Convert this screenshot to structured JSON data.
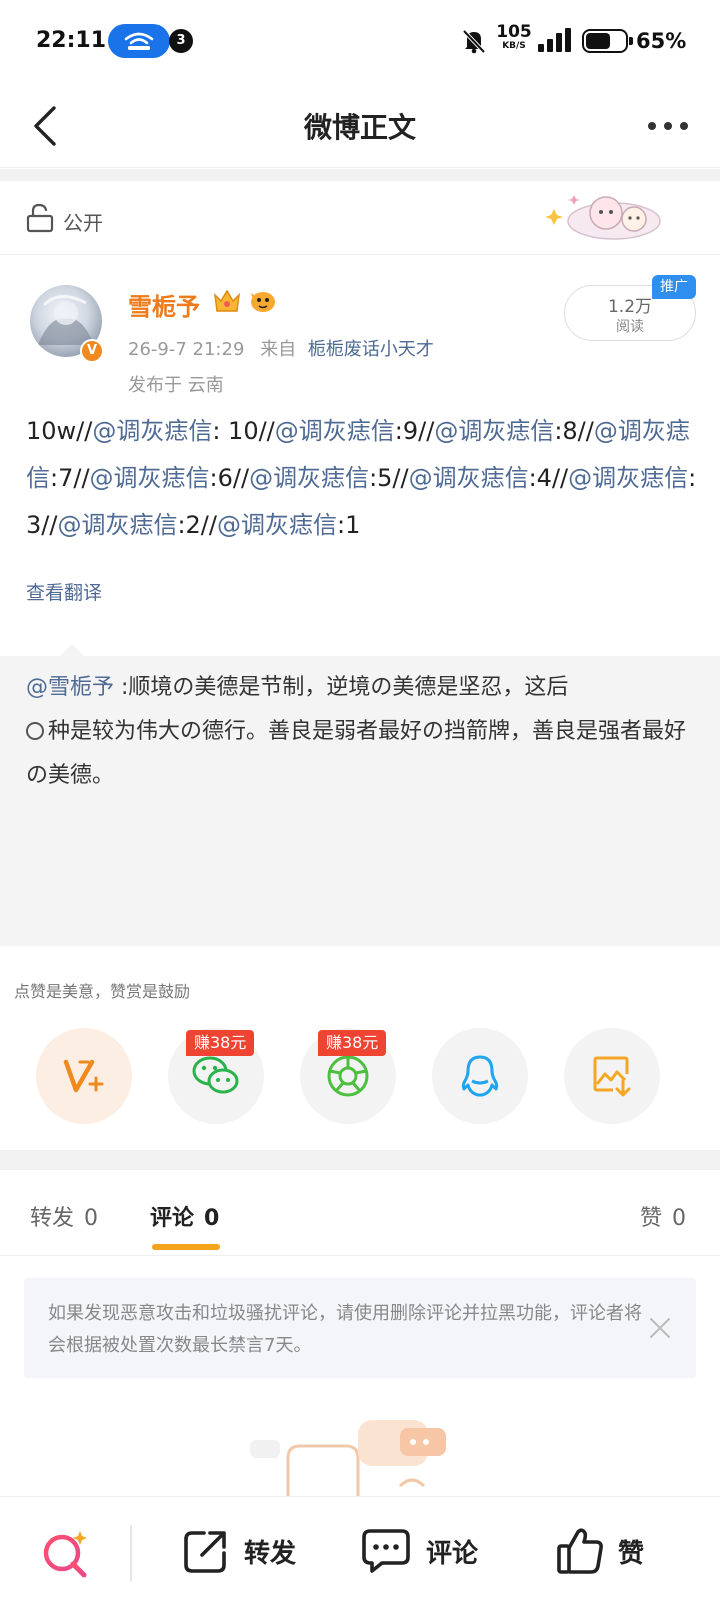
{
  "status_bar": {
    "time": "22:11",
    "notif_count": "3",
    "net_speed_value": "105",
    "net_speed_unit": "KB/S",
    "battery_pct": "65%",
    "battery_level": 0.65
  },
  "nav": {
    "title": "微博正文"
  },
  "visibility": {
    "label": "公开"
  },
  "author": {
    "name": "雪栀予",
    "verified_badge": "V",
    "date": "26-9-7 21:29",
    "from_prefix": "来自",
    "source": "栀栀废话小天才",
    "location": "发布于 云南",
    "reads_count": "1.2万",
    "reads_label": "阅读",
    "promo_label": "推广"
  },
  "post": {
    "segments": [
      {
        "t": "10w//",
        "m": false
      },
      {
        "t": "@调灰痣信",
        "m": true
      },
      {
        "t": ": 10//",
        "m": false
      },
      {
        "t": "@调灰痣信",
        "m": true
      },
      {
        "t": ":9//",
        "m": false
      },
      {
        "t": "@调灰痣信",
        "m": true
      },
      {
        "t": ":8//",
        "m": false
      },
      {
        "t": "@调灰痣信",
        "m": true
      },
      {
        "t": ":7//",
        "m": false
      },
      {
        "t": "@调灰痣信",
        "m": true
      },
      {
        "t": ":6//",
        "m": false
      },
      {
        "t": "@调灰痣信",
        "m": true
      },
      {
        "t": ":5//",
        "m": false
      },
      {
        "t": "@调灰痣信",
        "m": true
      },
      {
        "t": ":4//",
        "m": false
      },
      {
        "t": "@调灰痣信",
        "m": true
      },
      {
        "t": ":3//",
        "m": false
      },
      {
        "t": "@调灰痣信",
        "m": true
      },
      {
        "t": ":2//",
        "m": false
      },
      {
        "t": "@调灰痣信",
        "m": true
      },
      {
        "t": ":1",
        "m": false
      }
    ],
    "translate_label": "查看翻译"
  },
  "quoted": {
    "mention": "@雪栀予",
    "text_part1": " :顺境の美德是节制，逆境の美德是坚忍，这后",
    "text_part2": "种是较为伟大の德行。善良是弱者最好の挡箭牌，善良是强者最好の美德。"
  },
  "reward": {
    "tip": "点赞是美意，赞赏是鼓励",
    "earn_badge_1": "赚38元",
    "earn_badge_2": "赚38元",
    "share_icons": [
      "vplus-icon",
      "wechat-icon",
      "moments-icon",
      "qq-icon",
      "save-image-icon"
    ]
  },
  "tabs": {
    "repost_label": "转发",
    "repost_count": "0",
    "comment_label": "评论",
    "comment_count": "0",
    "like_label": "赞",
    "like_count": "0"
  },
  "notice": {
    "text": "如果发现恶意攻击和垃圾骚扰评论，请使用删除评论并拉黑功能，评论者将会根据被处置次数最长禁言7天。"
  },
  "bottom_bar": {
    "repost": "转发",
    "comment": "评论",
    "like": "赞"
  },
  "colors": {
    "accent_orange": "#ef7a1a",
    "mention_blue": "#4f6a93",
    "tab_underline": "#f3a41c",
    "earn_red": "#f04432"
  }
}
